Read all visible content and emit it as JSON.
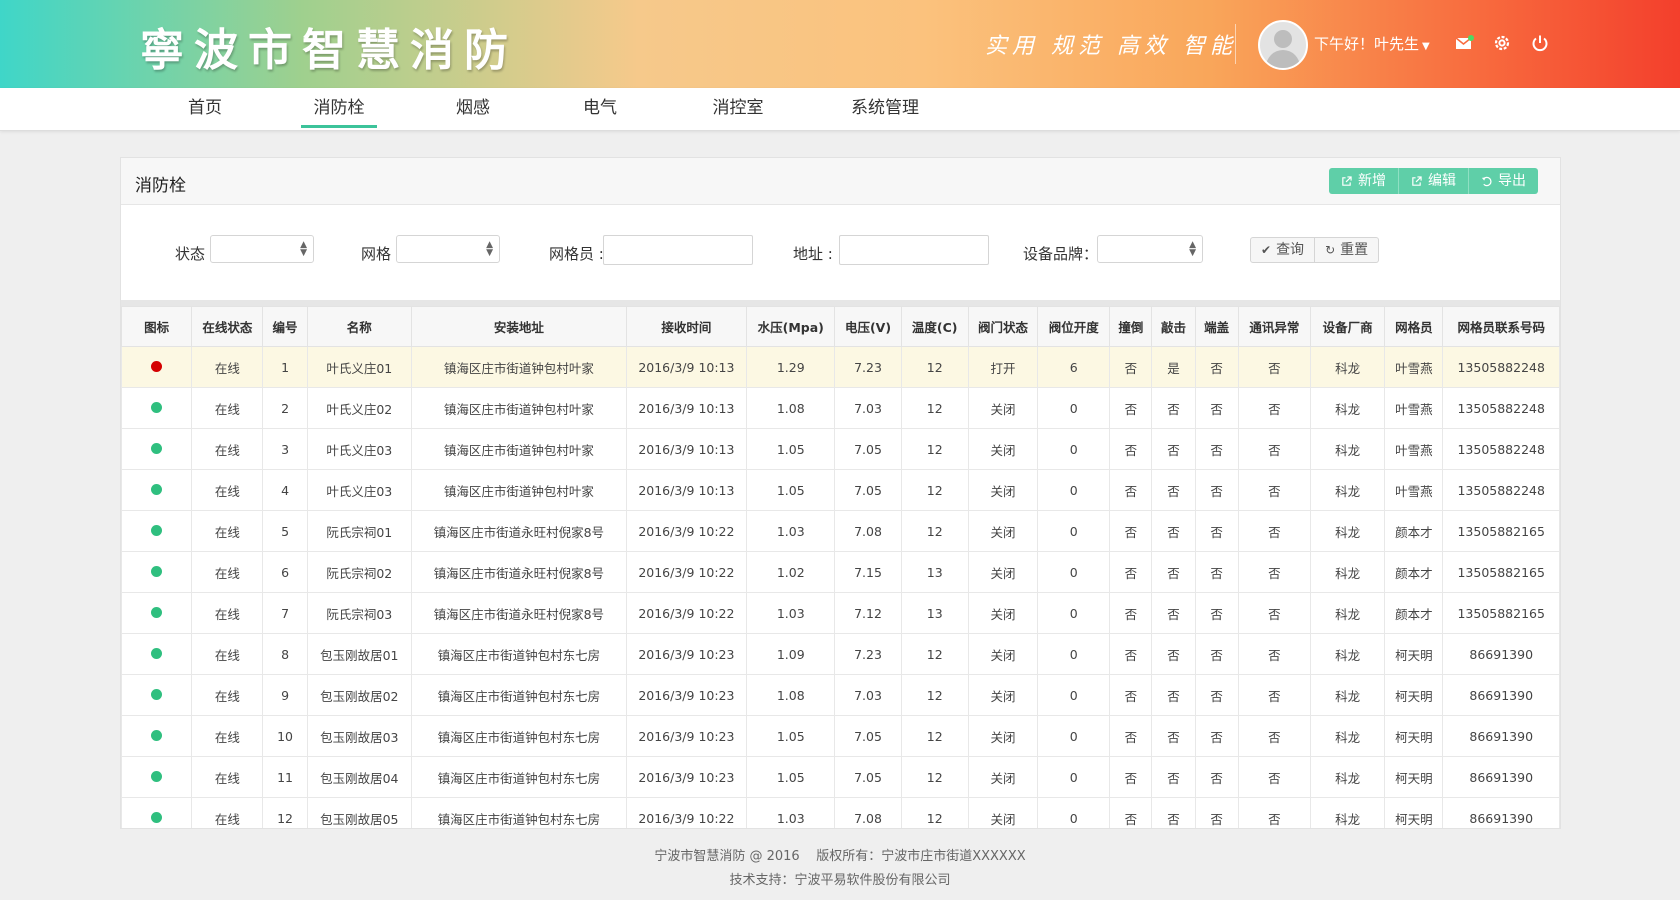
{
  "header": {
    "logo": "寧波市智慧消防",
    "slogan": "实用 规范 高效 智能",
    "greeting": "下午好！叶先生",
    "icons": [
      "mail-icon",
      "gear-icon",
      "power-icon"
    ]
  },
  "nav": [
    {
      "label": "首页",
      "active": false
    },
    {
      "label": "消防栓",
      "active": true
    },
    {
      "label": "烟感",
      "active": false
    },
    {
      "label": "电气",
      "active": false
    },
    {
      "label": "消控室",
      "active": false
    },
    {
      "label": "系统管理",
      "active": false
    }
  ],
  "panel": {
    "title": "消防栓",
    "actions": {
      "add": "新增",
      "edit": "编辑",
      "export": "导出"
    }
  },
  "filter": {
    "status_label": "状态",
    "grid_label": "网格",
    "gridman_label": "网格员",
    "address_label": "地址",
    "brand_label": "设备品牌",
    "query_label": "查询",
    "reset_label": "重置"
  },
  "colors": {
    "accent": "#5fcfa8",
    "online": "#2fbf7f",
    "alarm": "#d40000",
    "highlight": "#fcf8e3"
  },
  "table": {
    "columns": [
      "图标",
      "在线状态",
      "编号",
      "名称",
      "安装地址",
      "接收时间",
      "水压(Mpa)",
      "电压(V)",
      "温度(C)",
      "阀门状态",
      "阀位开度",
      "撞倒",
      "敲击",
      "端盖",
      "通讯异常",
      "设备厂商",
      "网格员",
      "网格员联系号码"
    ],
    "rows": [
      {
        "alarm": true,
        "cells": [
          "在线",
          "1",
          "叶氏义庄01",
          "镇海区庄市街道钟包村叶家",
          "2016/3/9 10:13",
          "1.29",
          "7.23",
          "12",
          "打开",
          "6",
          "否",
          "是",
          "否",
          "否",
          "科龙",
          "叶雪燕",
          "13505882248"
        ]
      },
      {
        "alarm": false,
        "cells": [
          "在线",
          "2",
          "叶氏义庄02",
          "镇海区庄市街道钟包村叶家",
          "2016/3/9 10:13",
          "1.08",
          "7.03",
          "12",
          "关闭",
          "0",
          "否",
          "否",
          "否",
          "否",
          "科龙",
          "叶雪燕",
          "13505882248"
        ]
      },
      {
        "alarm": false,
        "cells": [
          "在线",
          "3",
          "叶氏义庄03",
          "镇海区庄市街道钟包村叶家",
          "2016/3/9 10:13",
          "1.05",
          "7.05",
          "12",
          "关闭",
          "0",
          "否",
          "否",
          "否",
          "否",
          "科龙",
          "叶雪燕",
          "13505882248"
        ]
      },
      {
        "alarm": false,
        "cells": [
          "在线",
          "4",
          "叶氏义庄03",
          "镇海区庄市街道钟包村叶家",
          "2016/3/9 10:13",
          "1.05",
          "7.05",
          "12",
          "关闭",
          "0",
          "否",
          "否",
          "否",
          "否",
          "科龙",
          "叶雪燕",
          "13505882248"
        ]
      },
      {
        "alarm": false,
        "cells": [
          "在线",
          "5",
          "阮氏宗祠01",
          "镇海区庄市街道永旺村倪家8号",
          "2016/3/9 10:22",
          "1.03",
          "7.08",
          "12",
          "关闭",
          "0",
          "否",
          "否",
          "否",
          "否",
          "科龙",
          "颜本才",
          "13505882165"
        ]
      },
      {
        "alarm": false,
        "cells": [
          "在线",
          "6",
          "阮氏宗祠02",
          "镇海区庄市街道永旺村倪家8号",
          "2016/3/9 10:22",
          "1.02",
          "7.15",
          "13",
          "关闭",
          "0",
          "否",
          "否",
          "否",
          "否",
          "科龙",
          "颜本才",
          "13505882165"
        ]
      },
      {
        "alarm": false,
        "cells": [
          "在线",
          "7",
          "阮氏宗祠03",
          "镇海区庄市街道永旺村倪家8号",
          "2016/3/9 10:22",
          "1.03",
          "7.12",
          "13",
          "关闭",
          "0",
          "否",
          "否",
          "否",
          "否",
          "科龙",
          "颜本才",
          "13505882165"
        ]
      },
      {
        "alarm": false,
        "cells": [
          "在线",
          "8",
          "包玉刚故居01",
          "镇海区庄市街道钟包村东七房",
          "2016/3/9 10:23",
          "1.09",
          "7.23",
          "12",
          "关闭",
          "0",
          "否",
          "否",
          "否",
          "否",
          "科龙",
          "柯天明",
          "86691390"
        ]
      },
      {
        "alarm": false,
        "cells": [
          "在线",
          "9",
          "包玉刚故居02",
          "镇海区庄市街道钟包村东七房",
          "2016/3/9 10:23",
          "1.08",
          "7.03",
          "12",
          "关闭",
          "0",
          "否",
          "否",
          "否",
          "否",
          "科龙",
          "柯天明",
          "86691390"
        ]
      },
      {
        "alarm": false,
        "cells": [
          "在线",
          "10",
          "包玉刚故居03",
          "镇海区庄市街道钟包村东七房",
          "2016/3/9 10:23",
          "1.05",
          "7.05",
          "12",
          "关闭",
          "0",
          "否",
          "否",
          "否",
          "否",
          "科龙",
          "柯天明",
          "86691390"
        ]
      },
      {
        "alarm": false,
        "cells": [
          "在线",
          "11",
          "包玉刚故居04",
          "镇海区庄市街道钟包村东七房",
          "2016/3/9 10:23",
          "1.05",
          "7.05",
          "12",
          "关闭",
          "0",
          "否",
          "否",
          "否",
          "否",
          "科龙",
          "柯天明",
          "86691390"
        ]
      },
      {
        "alarm": false,
        "cells": [
          "在线",
          "12",
          "包玉刚故居05",
          "镇海区庄市街道钟包村东七房",
          "2016/3/9 10:22",
          "1.03",
          "7.08",
          "12",
          "关闭",
          "0",
          "否",
          "否",
          "否",
          "否",
          "科龙",
          "柯天明",
          "86691390"
        ]
      }
    ]
  },
  "footer": {
    "line1": "宁波市智慧消防 @ 2016    版权所有：宁波市庄市街道XXXXXX",
    "line2": "技术支持：宁波平易软件股份有限公司"
  }
}
